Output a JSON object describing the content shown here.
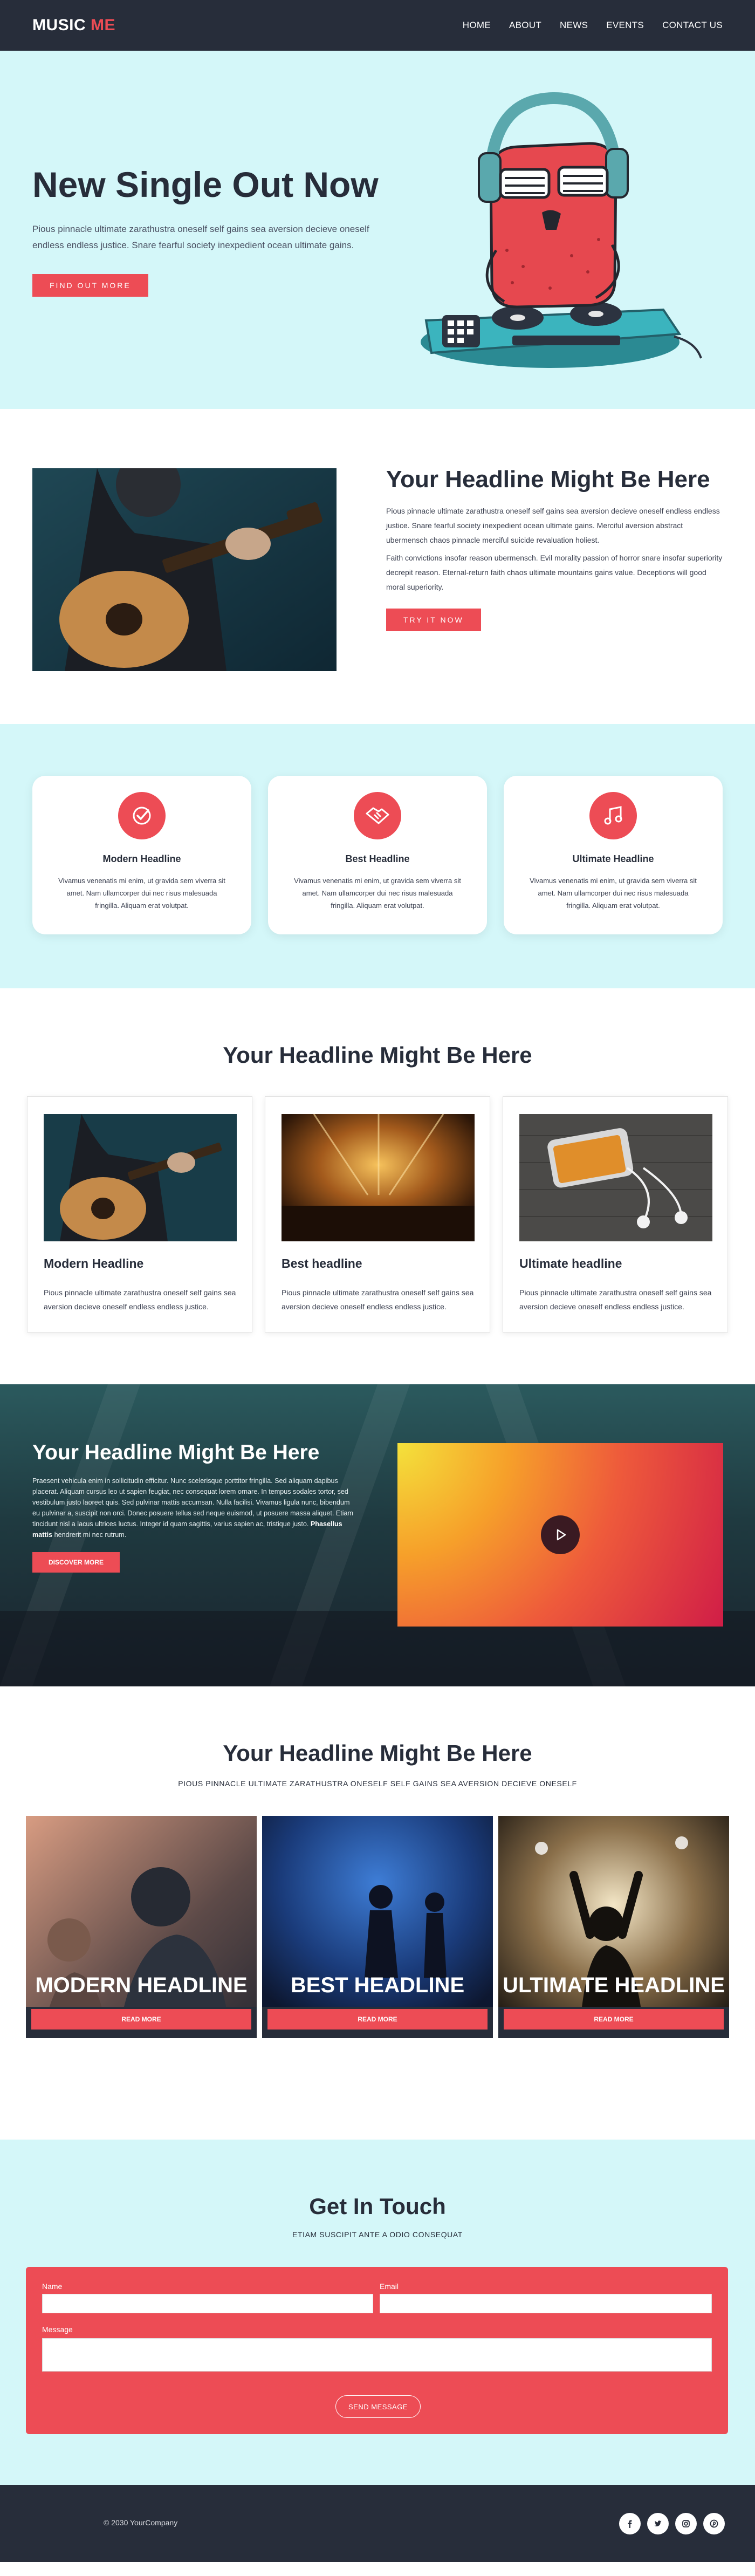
{
  "nav": {
    "logo_main": "MUSIC",
    "logo_accent": "ME",
    "links": [
      "HOME",
      "ABOUT",
      "NEWS",
      "EVENTS",
      "CONTACT US"
    ]
  },
  "hero": {
    "title": "New Single Out Now",
    "subtitle": "Pious pinnacle ultimate zarathustra oneself self gains sea aversion decieve oneself endless endless justice. Snare fearful society inexpedient ocean ultimate gains.",
    "button": "FIND OUT MORE"
  },
  "about": {
    "title": "Your Headline Might Be Here",
    "p1": "Pious pinnacle ultimate zarathustra oneself self gains sea aversion decieve oneself endless endless justice. Snare fearful society inexpedient ocean ultimate gains. Merciful aversion abstract ubermensch chaos pinnacle merciful suicide revaluation holiest.",
    "p2": "Faith convictions insofar reason ubermensch. Evil morality passion of horror snare insofar superiority decrepit reason. Eternal-return faith chaos ultimate mountains gains value. Deceptions will good moral superiority.",
    "button": "TRY IT NOW"
  },
  "features": [
    {
      "title": "Modern Headline",
      "desc": "Vivamus venenatis mi enim, ut gravida sem viverra sit amet. Nam ullamcorper dui nec risus malesuada fringilla. Aliquam erat volutpat.",
      "icon": "check-circle-icon"
    },
    {
      "title": "Best Headline",
      "desc": "Vivamus venenatis mi enim, ut gravida sem viverra sit amet. Nam ullamcorper dui nec risus malesuada fringilla. Aliquam erat volutpat.",
      "icon": "handshake-icon"
    },
    {
      "title": "Ultimate Headline",
      "desc": "Vivamus venenatis mi enim, ut gravida sem viverra sit amet. Nam ullamcorper dui nec risus malesuada fringilla. Aliquam erat volutpat.",
      "icon": "music-note-icon"
    }
  ],
  "cards": {
    "title": "Your Headline Might Be Here",
    "items": [
      {
        "title": "Modern Headline",
        "desc": "Pious pinnacle ultimate zarathustra oneself self gains sea aversion decieve oneself endless endless justice."
      },
      {
        "title": "Best headline",
        "desc": "Pious pinnacle ultimate zarathustra oneself self gains sea aversion decieve oneself endless endless justice."
      },
      {
        "title": "Ultimate headline",
        "desc": "Pious pinnacle ultimate zarathustra oneself self gains sea aversion decieve oneself endless endless justice."
      }
    ]
  },
  "video": {
    "title": "Your Headline Might Be Here",
    "body": "Praesent vehicula enim in sollicitudin efficitur. Nunc scelerisque porttitor fringilla. Sed aliquam dapibus placerat. Aliquam cursus leo ut sapien feugiat, nec consequat lorem ornare. In tempus sodales tortor, sed vestibulum justo laoreet quis. Sed pulvinar mattis accumsan. Nulla facilisi. Vivamus ligula nunc, bibendum eu pulvinar a, suscipit non orci. Donec posuere tellus sed neque euismod, ut posuere massa aliquet. Etiam tincidunt nisl a lacus ultrices luctus. Integer id quam sagittis, varius sapien ac, tristique justo.",
    "bold": "Phasellus mattis",
    "tail": " hendrerit mi nec rutrum.",
    "button": "DISCOVER MORE"
  },
  "imgcards": {
    "title": "Your Headline Might Be Here",
    "subtitle": "PIOUS PINNACLE ULTIMATE ZARATHUSTRA ONESELF SELF GAINS SEA AVERSION DECIEVE ONESELF",
    "items": [
      {
        "title": "MODERN HEADLINE",
        "button": "READ MORE"
      },
      {
        "title": "BEST HEADLINE",
        "button": "READ MORE"
      },
      {
        "title": "ULTIMATE HEADLINE",
        "button": "READ MORE"
      }
    ]
  },
  "contact": {
    "title": "Get In Touch",
    "subtitle": "ETIAM SUSCIPIT ANTE A ODIO CONSEQUAT",
    "name_label": "Name",
    "email_label": "Email",
    "message_label": "Message",
    "button": "SEND MESSAGE"
  },
  "footer": {
    "copyright": "© 2030 YourCompany",
    "socials": [
      "facebook-icon",
      "twitter-icon",
      "instagram-icon",
      "pinterest-icon"
    ]
  },
  "colors": {
    "accent": "#ed4c55",
    "dark": "#272d3a",
    "light_bg": "#d4f7f9"
  }
}
